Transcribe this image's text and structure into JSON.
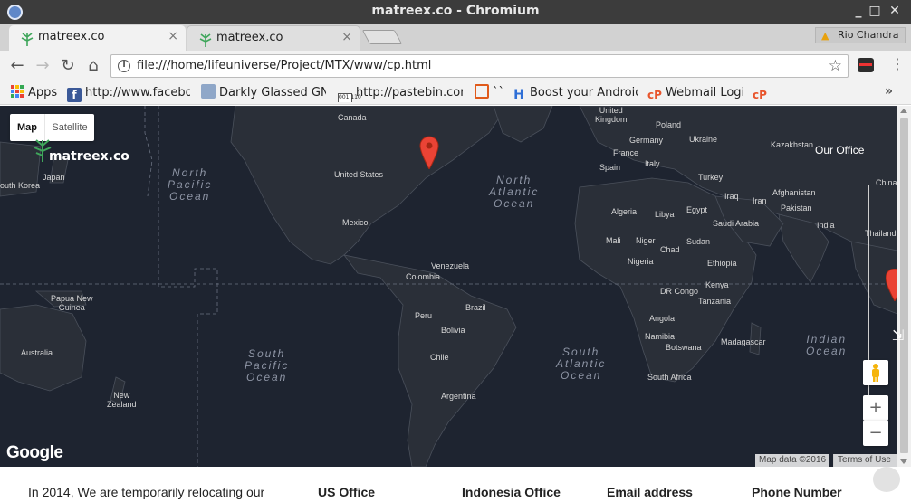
{
  "window": {
    "title": "matreex.co - Chromium",
    "minimize": "_",
    "maximize": "□",
    "close": "✕"
  },
  "tabs": [
    {
      "title": "matreex.co",
      "close": "×"
    },
    {
      "title": "matreex.co",
      "close": "×"
    }
  ],
  "profile": {
    "name": "Rio Chandra"
  },
  "toolbar": {
    "back": "←",
    "forward": "→",
    "reload": "↻",
    "home": "⌂",
    "url": "file:///home/lifeuniverse/Project/MTX/www/cp.html",
    "star": "☆",
    "menu": "⋮"
  },
  "bookmarks": {
    "items": [
      {
        "label": "Apps",
        "icon": "apps-grid-icon"
      },
      {
        "label": "http://www.faceboo",
        "icon": "facebook-icon"
      },
      {
        "label": "Darkly Glassed GNO",
        "icon": "darkly-icon"
      },
      {
        "label": "http://pastebin.com",
        "icon": "pastebin-icon"
      },
      {
        "label": "``",
        "icon": "blocks-icon"
      },
      {
        "label": "Boost your Android P",
        "icon": "boost-icon"
      },
      {
        "label": "Webmail Login",
        "icon": "cpanel-icon"
      },
      {
        "label": "",
        "icon": "cpanel-icon"
      }
    ],
    "more": "»"
  },
  "map": {
    "type_map": "Map",
    "type_satellite": "Satellite",
    "brand": "matreex.co",
    "office_label": "Our Office",
    "zoom_in": "+",
    "zoom_out": "−",
    "google": "Google",
    "map_data": "Map data ©2016",
    "terms": "Terms of Use",
    "labels": {
      "canada": "Canada",
      "us": "United States",
      "mexico": "Mexico",
      "venezuela": "Venezuela",
      "colombia": "Colombia",
      "peru": "Peru",
      "brazil": "Brazil",
      "bolivia": "Bolivia",
      "chile": "Chile",
      "argentina": "Argentina",
      "uk": "United\nKingdom",
      "poland": "Poland",
      "germany": "Germany",
      "ukraine": "Ukraine",
      "france": "France",
      "italy": "Italy",
      "spain": "Spain",
      "kazakhstan": "Kazakhstan",
      "turkey": "Turkey",
      "iraq": "Iraq",
      "iran": "Iran",
      "afghanistan": "Afghanistan",
      "pakistan": "Pakistan",
      "india": "India",
      "china": "China",
      "thailand": "Thailand",
      "saudi": "Saudi Arabia",
      "egypt": "Egypt",
      "libya": "Libya",
      "algeria": "Algeria",
      "mali": "Mali",
      "niger": "Niger",
      "chad": "Chad",
      "sudan": "Sudan",
      "nigeria": "Nigeria",
      "ethiopia": "Ethiopia",
      "kenya": "Kenya",
      "drcongo": "DR Congo",
      "tanzania": "Tanzania",
      "angola": "Angola",
      "namibia": "Namibia",
      "botswana": "Botswana",
      "madagascar": "Madagascar",
      "southafrica": "South Africa",
      "japan": "Japan",
      "southkorea": "outh Korea",
      "png": "Papua New\nGuinea",
      "australia": "Australia",
      "newzealand": "New\nZealand",
      "npacific": "North\nPacific\nOcean",
      "natlantic": "North\nAtlantic\nOcean",
      "spacific": "South\nPacific\nOcean",
      "satlantic": "South\nAtlantic\nOcean",
      "indian": "Indian\nOcean"
    }
  },
  "content": {
    "intro": "In 2014, We are temporarily relocating our",
    "us_office": "US Office",
    "indo_office": "Indonesia Office",
    "email": "Email address",
    "phone": "Phone Number"
  }
}
